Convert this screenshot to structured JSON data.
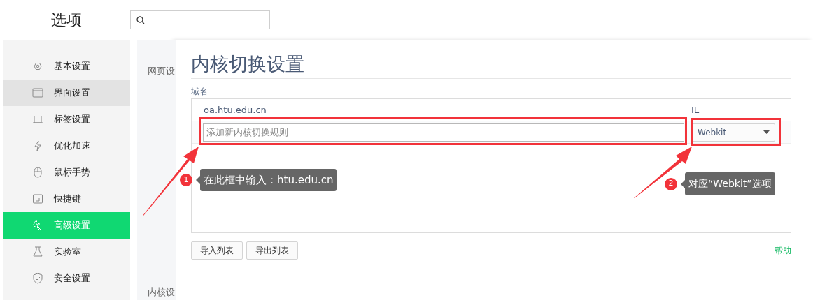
{
  "window": {
    "title": "选项"
  },
  "sidebar": {
    "items": [
      {
        "label": "基本设置",
        "selected": false,
        "highlighted": false
      },
      {
        "label": "界面设置",
        "selected": false,
        "highlighted": true
      },
      {
        "label": "标签设置",
        "selected": false,
        "highlighted": false
      },
      {
        "label": "优化加速",
        "selected": false,
        "highlighted": false
      },
      {
        "label": "鼠标手势",
        "selected": false,
        "highlighted": false
      },
      {
        "label": "快捷键",
        "selected": false,
        "highlighted": false
      },
      {
        "label": "高级设置",
        "selected": true,
        "highlighted": false
      },
      {
        "label": "实验室",
        "selected": false,
        "highlighted": false
      },
      {
        "label": "安全设置",
        "selected": false,
        "highlighted": false
      }
    ]
  },
  "background_panel": {
    "section_labels": [
      "网页设",
      "内核设"
    ]
  },
  "dialog": {
    "title": "内核切换设置",
    "field_label": "域名",
    "rules": [
      {
        "domain": "oa.htu.edu.cn",
        "engine": "IE"
      }
    ],
    "new_rule": {
      "placeholder": "添加新内核切换规则",
      "engine": "Webkit"
    },
    "buttons": [
      "导入列表",
      "导出列表"
    ],
    "help_link": "帮助"
  },
  "annotations": [
    {
      "number": "1",
      "text": "在此框中输入：htu.edu.cn"
    },
    {
      "number": "2",
      "text": "对应“Webkit”选项"
    }
  ]
}
